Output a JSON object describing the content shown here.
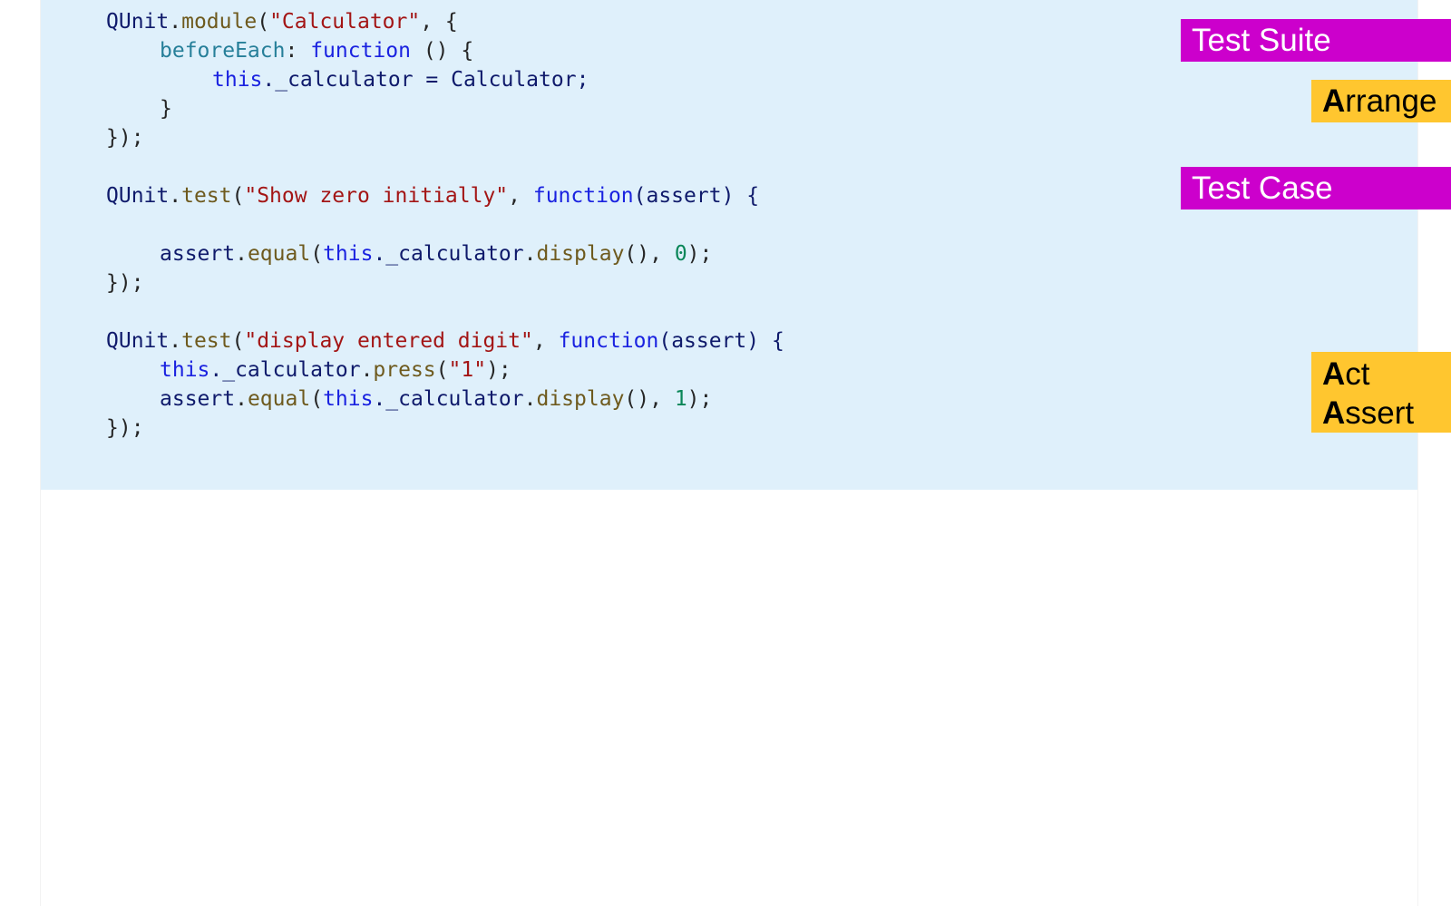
{
  "code": {
    "l1": {
      "a": "QUnit",
      "b": ".",
      "c": "module",
      "d": "(",
      "e": "\"Calculator\"",
      "f": ", {"
    },
    "l2": {
      "a": "beforeEach",
      "b": ": ",
      "c": "function",
      "d": " () {"
    },
    "l3": {
      "a": "this",
      "b": "._calculator = Calculator;"
    },
    "l4": {
      "a": "}"
    },
    "l5": {
      "a": "});"
    },
    "l7": {
      "a": "QUnit",
      "b": ".",
      "c": "test",
      "d": "(",
      "e": "\"Show zero initially\"",
      "f": ", ",
      "g": "function",
      "h": "(assert) {"
    },
    "l9": {
      "a": "assert",
      "b": ".",
      "c": "equal",
      "d": "(",
      "e": "this",
      "f": "._calculator",
      "g": ".",
      "h": "display",
      "i": "(), ",
      "j": "0",
      "k": ");"
    },
    "l10": {
      "a": "});"
    },
    "l12": {
      "a": "QUnit",
      "b": ".",
      "c": "test",
      "d": "(",
      "e": "\"display entered digit\"",
      "f": ", ",
      "g": "function",
      "h": "(assert) {"
    },
    "l13": {
      "a": "this",
      "b": "._calculator",
      "c": ".",
      "d": "press",
      "e": "(",
      "f": "\"1\"",
      "g": ");"
    },
    "l14": {
      "a": "assert",
      "b": ".",
      "c": "equal",
      "d": "(",
      "e": "this",
      "f": "._calculator",
      "g": ".",
      "h": "display",
      "i": "(), ",
      "j": "1",
      "k": ");"
    },
    "l15": {
      "a": "});"
    }
  },
  "labels": {
    "test_suite": "Test Suite",
    "arrange_first": "A",
    "arrange_rest": "rrange",
    "test_case": "Test Case",
    "act_first": "A",
    "act_rest": "ct",
    "assert_first": "A",
    "assert_rest": "ssert"
  },
  "colors": {
    "panel_background": "#dff0fb",
    "magenta_label": "#cc00cc",
    "yellow_label": "#ffc62f"
  }
}
